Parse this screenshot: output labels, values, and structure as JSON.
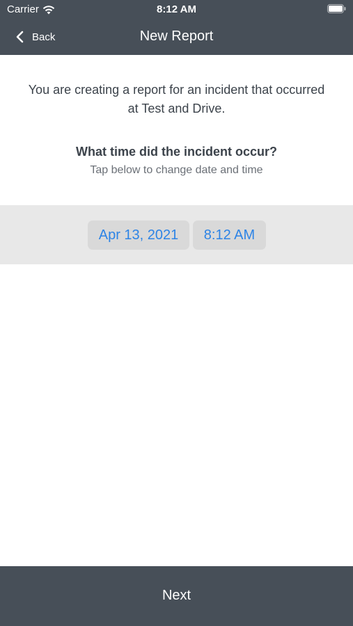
{
  "status_bar": {
    "carrier": "Carrier",
    "time": "8:12 AM",
    "icons": [
      "wifi-icon",
      "battery-icon"
    ]
  },
  "nav": {
    "back_label": "Back",
    "title": "New Report",
    "back_icon": "chevron-left-icon"
  },
  "content": {
    "intro": "You are creating a report for an incident that occurred at Test and Drive.",
    "question": "What time did the incident occur?",
    "hint": "Tap below to change date and time"
  },
  "picker": {
    "date": "Apr 13, 2021",
    "time": "8:12 AM"
  },
  "footer": {
    "next_label": "Next"
  },
  "colors": {
    "bar": "#474f58",
    "accent": "#2d84e6",
    "picker_band": "#e8e8e8",
    "pill": "#d9d9d9",
    "text": "#3c434b"
  }
}
